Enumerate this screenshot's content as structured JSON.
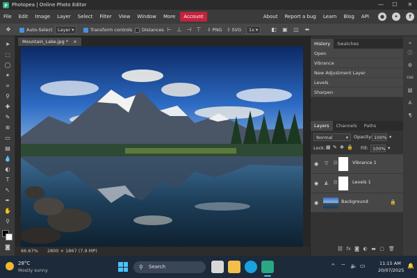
{
  "window": {
    "title": "Photopea | Online Photo Editor",
    "minimize": "—",
    "maximize": "☐",
    "close": "✕"
  },
  "menu": {
    "left": [
      "File",
      "Edit",
      "Image",
      "Layer",
      "Select",
      "Filter",
      "View",
      "Window",
      "More"
    ],
    "account": "Account",
    "right": [
      "About",
      "Report a bug",
      "Learn",
      "Blog",
      "API"
    ]
  },
  "options": {
    "auto_select_label": "Auto-Select",
    "auto_select_target": "Layer",
    "transform_controls_label": "Transform controls",
    "distances_label": "Distances",
    "export_png": "PNG",
    "export_svg": "SVG",
    "zoom_select": "1x"
  },
  "document": {
    "tab_title": "Mountain_Lake.jpg *",
    "tab_close": "×",
    "zoom": "66.67%",
    "info": "2800 × 1867 (7.9 MP)"
  },
  "history": {
    "tabs": [
      "History",
      "Swatches"
    ],
    "items": [
      "Open",
      "Vibrance",
      "New Adjustment Layer",
      "Levels",
      "Sharpen"
    ]
  },
  "layers": {
    "tabs": [
      "Layers",
      "Channels",
      "Paths"
    ],
    "blend_mode": "Normal",
    "opacity_label": "Opacity:",
    "opacity_value": "100%",
    "lock_label": "Lock:",
    "fill_label": "Fill:",
    "fill_value": "100%",
    "items": [
      {
        "name": "Vibrance 1",
        "type_icon": "▽"
      },
      {
        "name": "Levels 1",
        "type_icon": "◭"
      },
      {
        "name": "Background",
        "type_icon": ""
      }
    ]
  },
  "strip": {
    "css_label": "css"
  },
  "taskbar": {
    "weather_temp": "28°C",
    "weather_desc": "Mostly sunny",
    "search_placeholder": "Search",
    "time": "11:15 AM",
    "date": "20/07/2025"
  },
  "colors": {
    "accent_red": "#c4223d",
    "photopea_green": "#2aa784",
    "checkbox_blue": "#4a90e2"
  }
}
